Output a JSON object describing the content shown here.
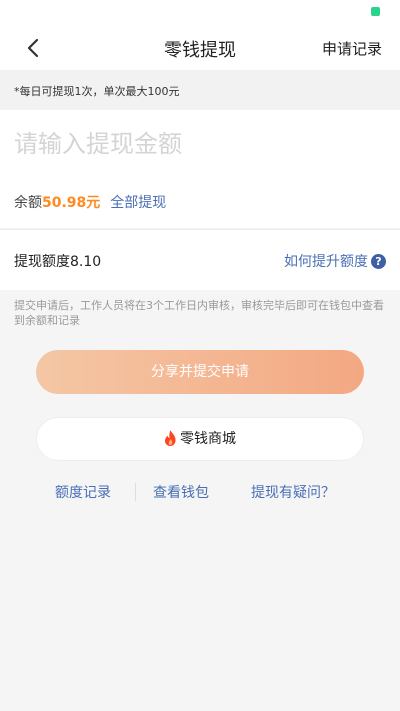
{
  "nav": {
    "title": "零钱提现",
    "right_label": "申请记录"
  },
  "notice": "*每日可提现1次，单次最大100元",
  "input": {
    "placeholder": "请输入提现金额",
    "value": ""
  },
  "balance": {
    "label": "余额",
    "value": "50.98元",
    "withdraw_all": "全部提现"
  },
  "quota": {
    "label": "提现额度8.10",
    "help_label": "如何提升额度",
    "help_icon": "?"
  },
  "description": "提交申请后，工作人员将在3个工作日内审核，审核完毕后即可在钱包中查看到余额和记录",
  "buttons": {
    "share": "分享并提交申请",
    "mall": "零钱商城"
  },
  "links": [
    "额度记录",
    "查看钱包",
    "提现有疑问？"
  ],
  "colors": {
    "accent_orange": "#ff8a1f",
    "link_blue": "#4a6fb5",
    "status_green": "#2bd28c",
    "fire_red": "#ff4422"
  }
}
